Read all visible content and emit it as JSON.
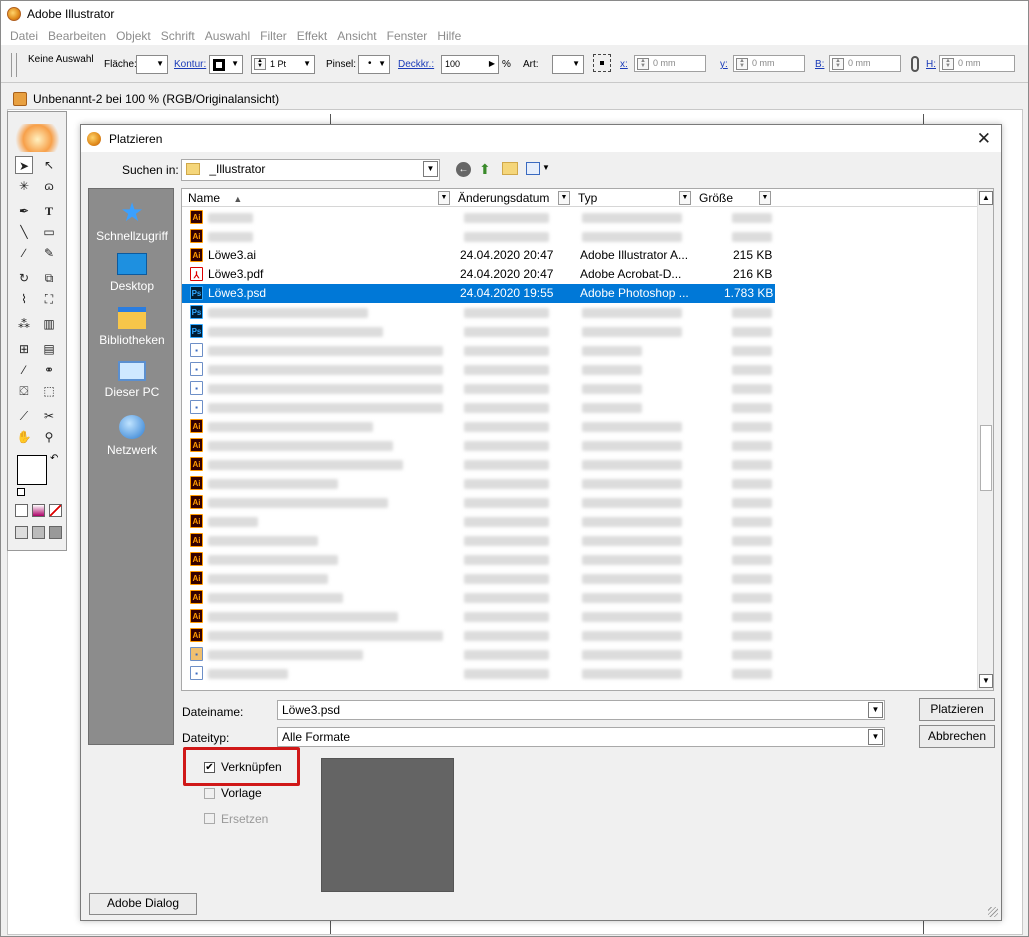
{
  "app": {
    "title": "Adobe Illustrator"
  },
  "menu": [
    "Datei",
    "Bearbeiten",
    "Objekt",
    "Schrift",
    "Auswahl",
    "Filter",
    "Effekt",
    "Ansicht",
    "Fenster",
    "Hilfe"
  ],
  "control": {
    "selection": "Keine Auswahl",
    "flaeche": "Fläche:",
    "kontur": "Kontur:",
    "stroke_weight": "1 Pt",
    "pinsel": "Pinsel:",
    "deckkr": "Deckkr.:",
    "opacity": "100",
    "percent": "%",
    "art": "Art:",
    "x_label": "x:",
    "x_val": "0 mm",
    "y_label": "y:",
    "y_val": "0 mm",
    "b_label": "B:",
    "b_val": "0 mm",
    "h_label": "H:",
    "h_val": "0 mm"
  },
  "document": {
    "tab_title": "Unbenannt-2 bei 100 % (RGB/Originalansicht)"
  },
  "dialog": {
    "title": "Platzieren",
    "look_in_label": "Suchen in:",
    "look_in_value": "_Illustrator",
    "places": [
      "Schnellzugriff",
      "Desktop",
      "Bibliotheken",
      "Dieser PC",
      "Netzwerk"
    ],
    "columns": {
      "name": "Name",
      "date": "Änderungsdatum",
      "type": "Typ",
      "size": "Größe"
    },
    "files": [
      {
        "name": "Löwe3.ai",
        "date": "24.04.2020 20:47",
        "type": "Adobe Illustrator A...",
        "size": "215 KB",
        "icon": "ai"
      },
      {
        "name": "Löwe3.pdf",
        "date": "24.04.2020 20:47",
        "type": "Adobe Acrobat-D...",
        "size": "216 KB",
        "icon": "pdf"
      },
      {
        "name": "Löwe3.psd",
        "date": "24.04.2020 19:55",
        "type": "Adobe Photoshop ...",
        "size": "1.783 KB",
        "icon": "ps",
        "selected": true
      }
    ],
    "filename_label": "Dateiname:",
    "filename_value": "Löwe3.psd",
    "filetype_label": "Dateityp:",
    "filetype_value": "Alle Formate",
    "place_button": "Platzieren",
    "cancel_button": "Abbrechen",
    "link_label": "Verknüpfen",
    "link_checked": true,
    "template_label": "Vorlage",
    "replace_label": "Ersetzen",
    "adobe_dialog_button": "Adobe Dialog"
  }
}
